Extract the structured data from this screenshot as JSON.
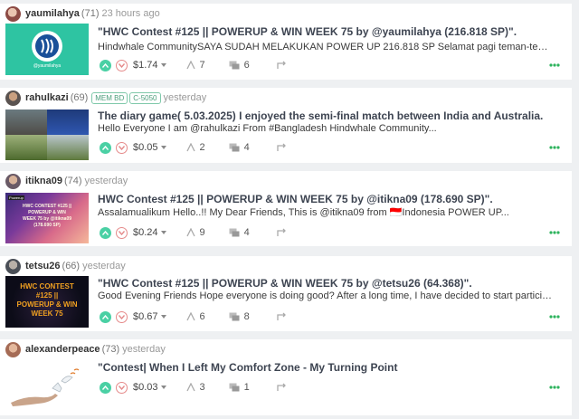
{
  "posts": [
    {
      "author": "yaumilahya",
      "reputation": "(71)",
      "time": "23 hours ago",
      "title": "\"HWC Contest #125 || POWERUP & WIN WEEK 75 by @yaumilahya (216.818 SP)\".",
      "body": "Hindwhale CommunitySAYA SUDAH MELAKUKAN POWER UP 216.818 SP Selamat pagi teman-teman senang bisa ikut...",
      "payout": "$1.74",
      "votes": "7",
      "comments": "6",
      "thumb_caption": "@yaumilahya",
      "thumb_icon": "steem-logo-icon"
    },
    {
      "author": "rahulkazi",
      "reputation": "(69)",
      "time": "yesterday",
      "tags": [
        "MEM BD",
        "C-5050"
      ],
      "title": "The diary game( 5.03.2025) I enjoyed the semi-final match between India and Australia.",
      "body": "Hello Everyone I am @rahulkazi From #Bangladesh Hindwhale Community...",
      "payout": "$0.05",
      "votes": "2",
      "comments": "4"
    },
    {
      "author": "itikna09",
      "reputation": "(74)",
      "time": "yesterday",
      "title": "HWC Contest #125 || POWERUP & WIN WEEK 75 by @itikna09 (178.690 SP)\".",
      "body": "Assalamualikum Hello..!! My Dear Friends, This is @itikna09 from 🇮🇩Indonesia POWER UP...",
      "payout": "$0.24",
      "votes": "9",
      "comments": "4",
      "thumb_lines": [
        "HWC CONTEST #125 ||",
        "POWERUP & WIN",
        "WEEK 75 by @itikna09",
        "(178.690 SP)"
      ],
      "thumb_badge": "Powerup"
    },
    {
      "author": "tetsu26",
      "reputation": "(66)",
      "time": "yesterday",
      "title": "\"HWC Contest #125 || POWERUP & WIN WEEK 75 by @tetsu26 (64.368)\".",
      "body": "Good Evening Friends Hope everyone is doing good? After a long time, I have decided to start participating in this...",
      "payout": "$0.67",
      "votes": "6",
      "comments": "8",
      "thumb_lines": [
        "HWC CONTEST",
        "#125 ||",
        "POWERUP & WIN",
        "WEEK 75"
      ]
    },
    {
      "author": "alexanderpeace",
      "reputation": "(73)",
      "time": "yesterday",
      "title": "\"Contest| When I Left My Comfort Zone - My Turning Point",
      "body": "",
      "payout": "$0.03",
      "votes": "3",
      "comments": "1"
    }
  ],
  "colors": {
    "upvote": "#4ad0a4",
    "downvote": "#e58a8a",
    "menu_dots": "#2db35d",
    "background": "#eef0f2"
  },
  "icons": {
    "upvote": "chevron-up-icon",
    "downvote": "chevron-down-icon",
    "votes": "thumbs-up-icon",
    "comments": "comment-icon",
    "resteem": "resteem-icon",
    "menu": "more-dots-icon"
  }
}
